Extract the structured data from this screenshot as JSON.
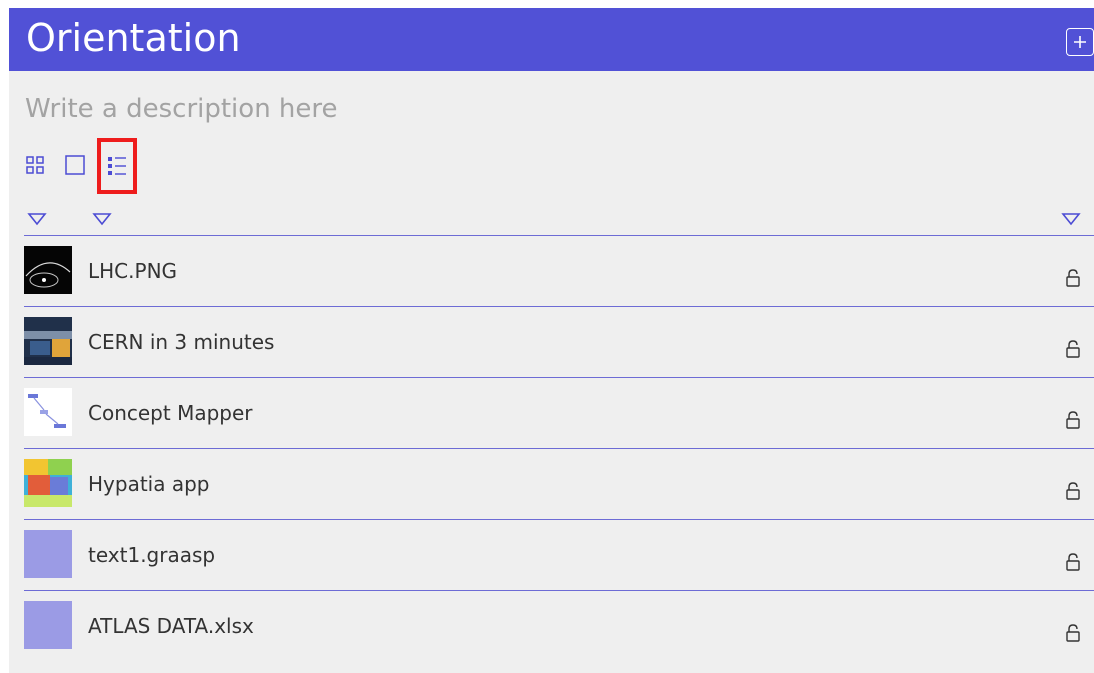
{
  "header": {
    "title": "Orientation",
    "add_icon": "plus-square-icon",
    "background": "#5151d6"
  },
  "description_placeholder": "Write a description here",
  "view_modes": [
    {
      "name": "grid-view",
      "icon": "grid-icon",
      "active": false
    },
    {
      "name": "single-view",
      "icon": "square-icon",
      "active": false
    },
    {
      "name": "list-view",
      "icon": "list-icon",
      "active": true,
      "highlighted": true
    }
  ],
  "columns": {
    "sort_icons": [
      "triangle-down-icon",
      "triangle-down-icon",
      "triangle-down-icon"
    ]
  },
  "items": [
    {
      "name": "LHC.PNG",
      "thumb": "dark-image",
      "lock_icon": "unlock-icon"
    },
    {
      "name": "CERN in 3 minutes",
      "thumb": "video-image",
      "lock_icon": "unlock-icon"
    },
    {
      "name": "Concept Mapper",
      "thumb": "concept-map-image",
      "lock_icon": "unlock-icon"
    },
    {
      "name": "Hypatia app",
      "thumb": "colorful-image",
      "lock_icon": "unlock-icon"
    },
    {
      "name": "text1.graasp",
      "thumb": "placeholder",
      "lock_icon": "unlock-icon"
    },
    {
      "name": "ATLAS DATA.xlsx",
      "thumb": "placeholder",
      "lock_icon": "unlock-icon"
    }
  ],
  "colors": {
    "accent": "#5151d6",
    "divider": "#6d6bd5",
    "placeholder_thumb": "#9b9be5",
    "highlight_box": "#ee1c1c"
  }
}
